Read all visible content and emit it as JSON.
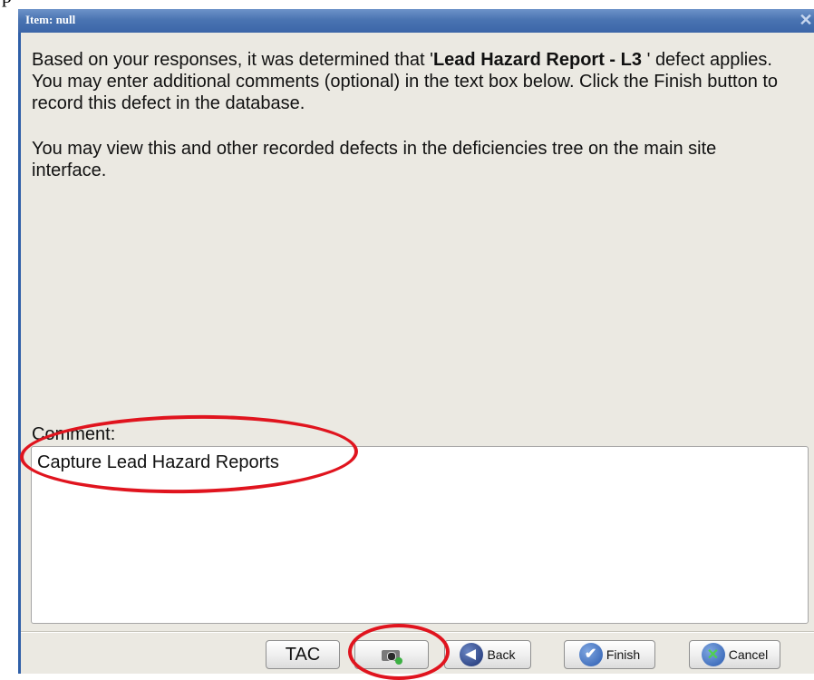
{
  "window": {
    "title": "Item: null",
    "close_glyph": "✕"
  },
  "message": {
    "line1_prefix": "Based on your responses, it was determined that '",
    "defect_name": "Lead Hazard Report - L3 ",
    "line1_suffix": "' defect applies. You may enter additional comments (optional) in the text box below. Click the Finish button to record this defect in the database.",
    "paragraph2": "You may view this and other recorded defects in the deficiencies tree on the main site interface."
  },
  "comment": {
    "label": "Comment:",
    "value": "Capture Lead Hazard Reports"
  },
  "buttons": {
    "tac": "TAC",
    "camera_icon": "camera-icon",
    "back": "Back",
    "finish": "Finish",
    "cancel": "Cancel"
  },
  "colors": {
    "titlebar": "#4a74b2",
    "dialog_bg": "#ebe9e2",
    "annotation": "#e0141e"
  }
}
